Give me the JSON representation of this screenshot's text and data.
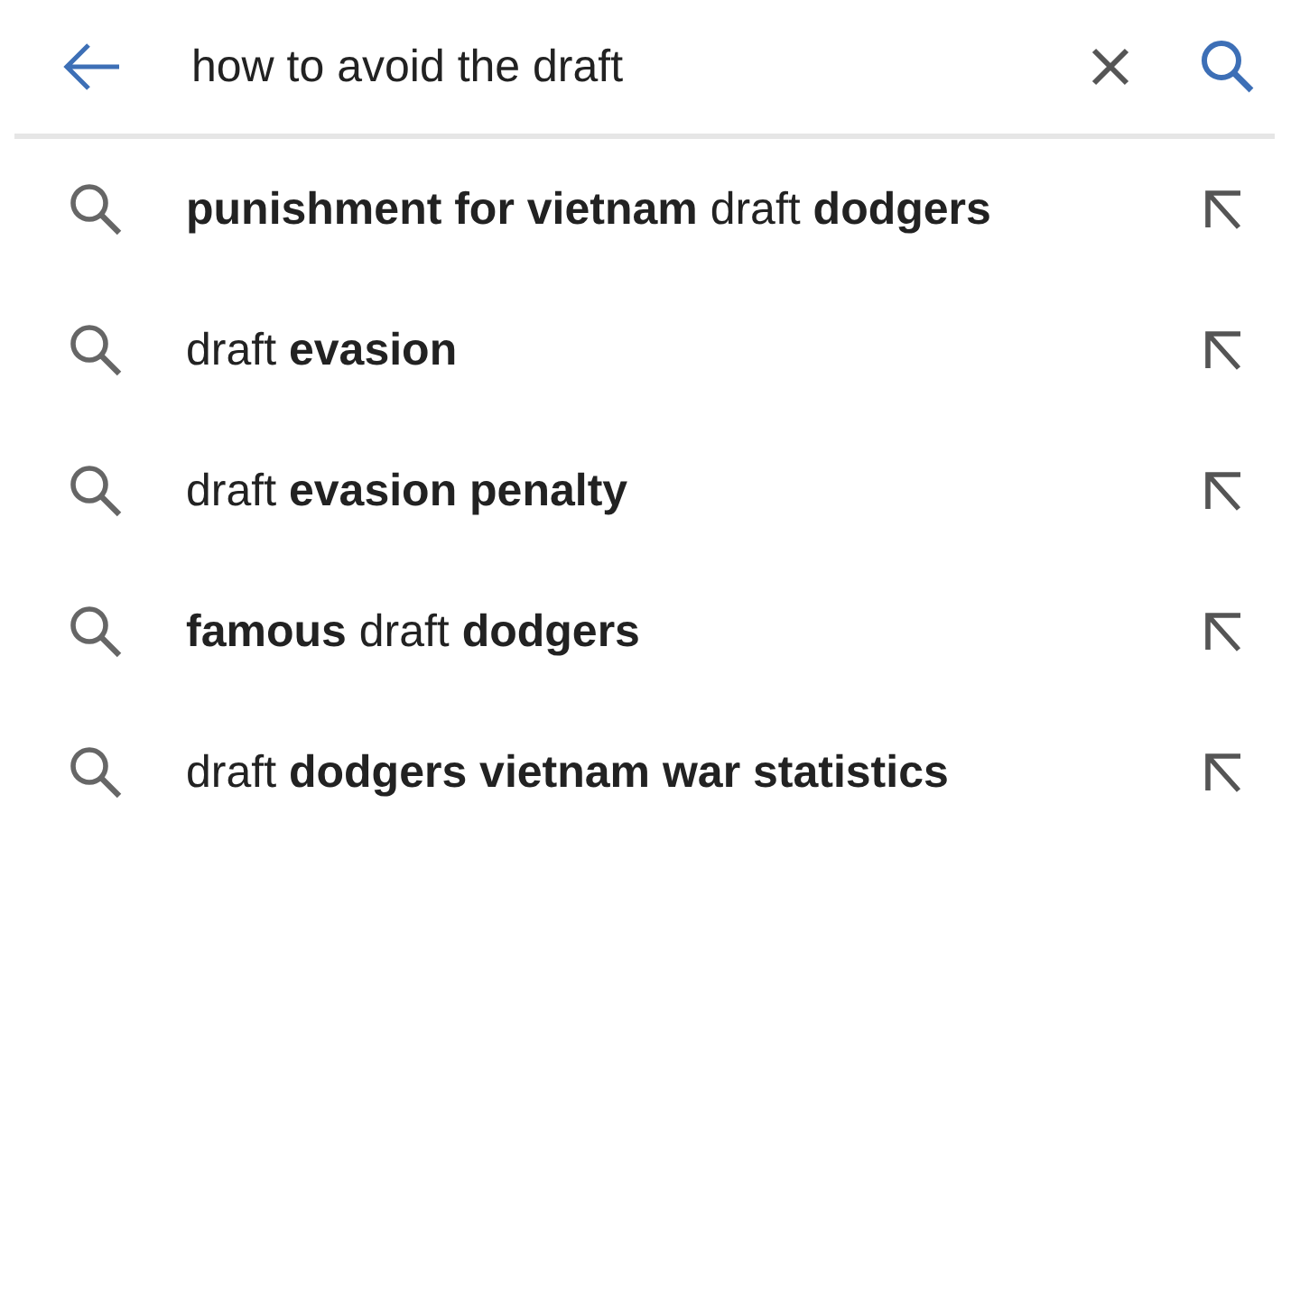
{
  "search": {
    "value": "how to avoid the draft"
  },
  "suggestions": [
    {
      "text": "**punishment for vietnam** draft **dodgers**"
    },
    {
      "text": "draft **evasion**"
    },
    {
      "text": "draft **evasion penalty**"
    },
    {
      "text": "**famous** draft **dodgers**"
    },
    {
      "text": "draft **dodgers vietnam war statistics**"
    }
  ]
}
